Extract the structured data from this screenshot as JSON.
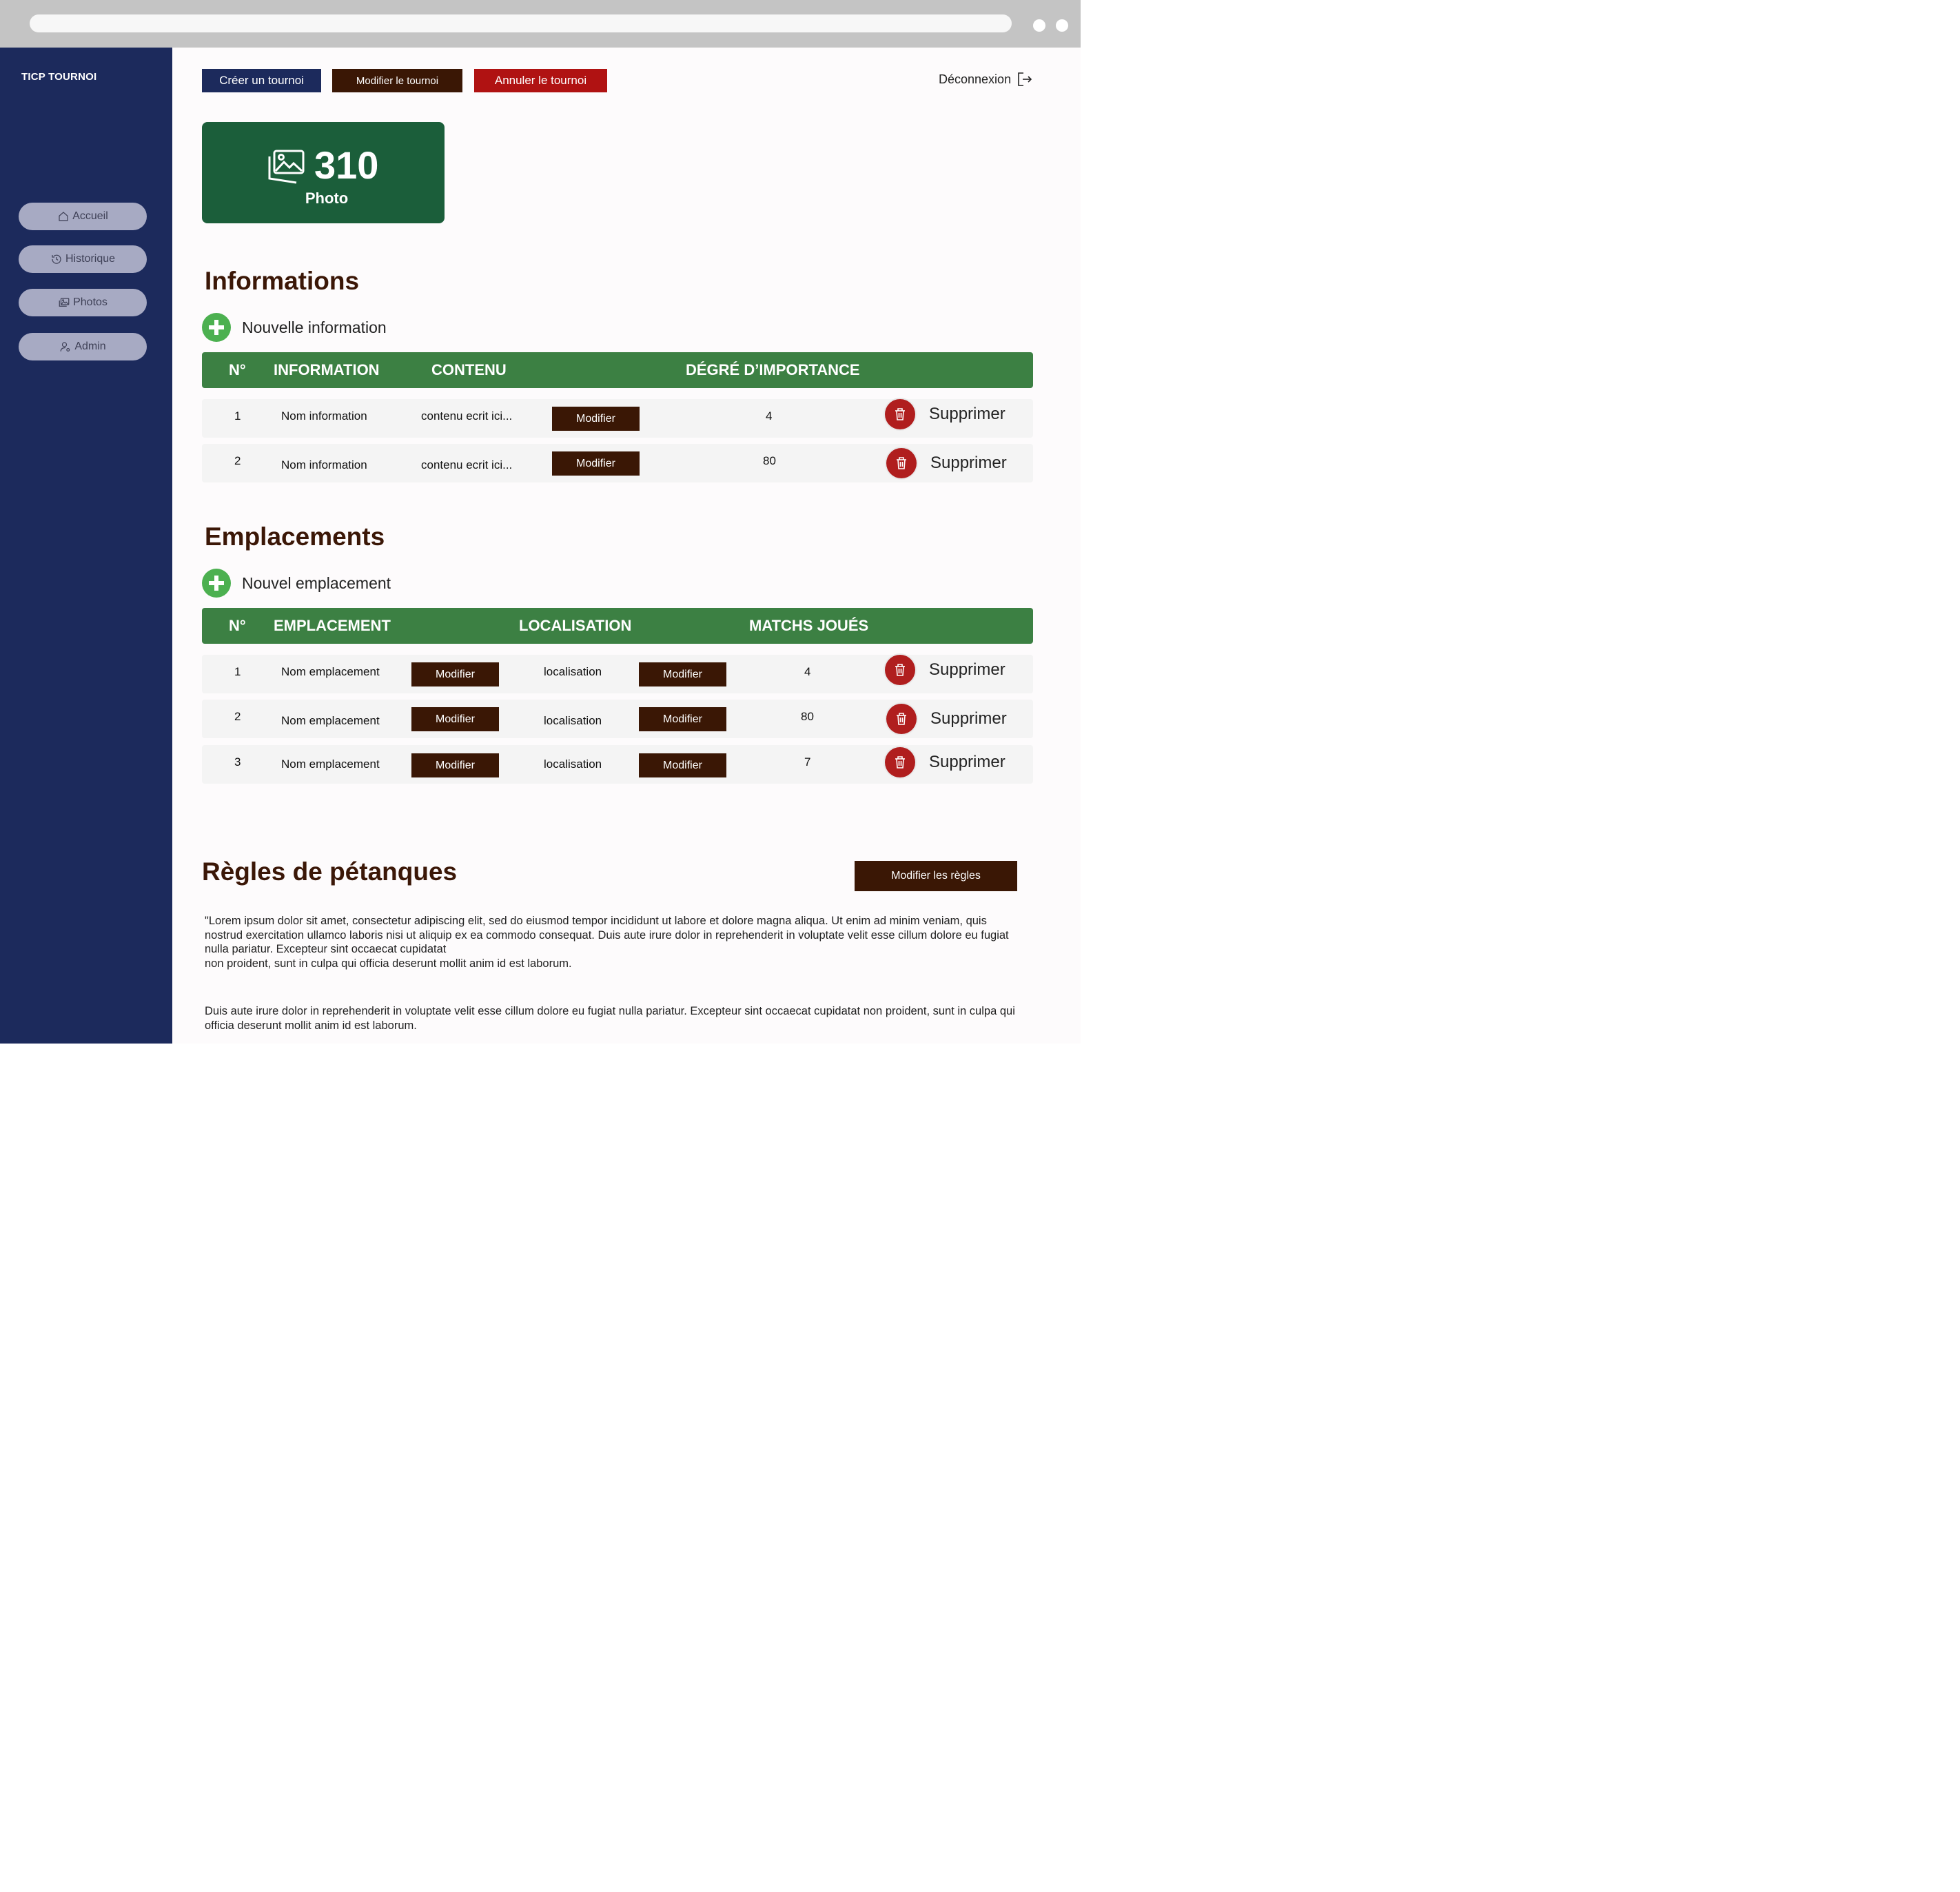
{
  "app": {
    "brand": "TICP TOURNOI"
  },
  "sidebar": {
    "items": [
      {
        "label": "Accueil",
        "icon": "home-icon"
      },
      {
        "label": "Historique",
        "icon": "history-icon"
      },
      {
        "label": "Photos",
        "icon": "photos-icon"
      },
      {
        "label": "Admin",
        "icon": "admin-icon"
      }
    ]
  },
  "toolbar": {
    "create_label": "Créer un tournoi",
    "modify_label": "Modifier le tournoi",
    "cancel_label": "Annuler le tournoi",
    "logout_label": "Déconnexion"
  },
  "photo_card": {
    "count": "310",
    "label": "Photo"
  },
  "informations": {
    "title": "Informations",
    "add_label": "Nouvelle information",
    "headers": [
      "N°",
      "INFORMATION",
      "CONTENU",
      "DÉGRÉ D’IMPORTANCE"
    ],
    "rows": [
      {
        "num": "1",
        "name": "Nom information",
        "content": "contenu ecrit ici...",
        "modify": "Modifier",
        "importance": "4",
        "delete": "Supprimer"
      },
      {
        "num": "2",
        "name": "Nom information",
        "content": "contenu ecrit ici...",
        "modify": "Modifier",
        "importance": "80",
        "delete": "Supprimer"
      }
    ]
  },
  "emplacements": {
    "title": "Emplacements",
    "add_label": "Nouvel emplacement",
    "headers": [
      "N°",
      "EMPLACEMENT",
      "LOCALISATION",
      "MATCHS JOUÉS"
    ],
    "rows": [
      {
        "num": "1",
        "name": "Nom emplacement",
        "modify_name": "Modifier",
        "location": "localisation",
        "modify_location": "Modifier",
        "matches": "4",
        "delete": "Supprimer"
      },
      {
        "num": "2",
        "name": "Nom emplacement",
        "modify_name": "Modifier",
        "location": "localisation",
        "modify_location": "Modifier",
        "matches": "80",
        "delete": "Supprimer"
      },
      {
        "num": "3",
        "name": "Nom emplacement",
        "modify_name": "Modifier",
        "location": "localisation",
        "modify_location": "Modifier",
        "matches": "7",
        "delete": "Supprimer"
      }
    ]
  },
  "regles": {
    "title": "Règles de pétanques",
    "modify_label": "Modifier les règles",
    "paragraph_1": "\"Lorem ipsum dolor sit amet, consectetur adipiscing elit, sed do eiusmod tempor incididunt ut labore et dolore magna aliqua. Ut enim ad minim veniam, quis nostrud exercitation ullamco laboris nisi ut aliquip ex ea commodo consequat. Duis aute irure dolor in reprehenderit in voluptate velit esse cillum dolore eu fugiat nulla pariatur. Excepteur sint occaecat cupidatat\nnon proident, sunt in culpa qui officia deserunt mollit anim id est laborum.",
    "paragraph_2": "Duis aute irure dolor in reprehenderit in voluptate velit esse cillum dolore eu fugiat nulla pariatur. Excepteur sint occaecat cupidatat non proident, sunt in culpa qui officia deserunt mollit anim id est laborum."
  },
  "colors": {
    "sidebar": "#1c2a5c",
    "create_button": "#1c2a5c",
    "modify_button": "#3a1705",
    "cancel_button": "#b01212",
    "photo_card": "#1b5e3a",
    "table_header": "#3c8043",
    "add_icon": "#4cb050",
    "delete_icon": "#b01e1e",
    "heading": "#3b1707"
  }
}
